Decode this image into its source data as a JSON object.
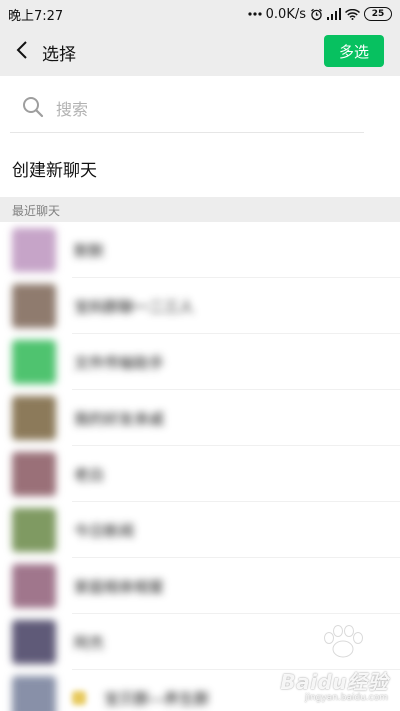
{
  "status_bar": {
    "time": "晚上7:27",
    "net_speed": "0.0K/s",
    "battery": "25"
  },
  "header": {
    "title": "选择",
    "multi_select": "多选"
  },
  "search": {
    "placeholder": "搜索"
  },
  "create_chat": "创建新聊天",
  "section_title": "最近聊天",
  "recent_chats": [
    {
      "name": "默默",
      "avatar_color": "#c6a4c8"
    },
    {
      "name": "宝妈群聊一二三人",
      "avatar_color": "#8f7b6e"
    },
    {
      "name": "文件传输助手",
      "avatar_color": "#4fc36f"
    },
    {
      "name": "我的好友亲戚",
      "avatar_color": "#8c7a5a"
    },
    {
      "name": "老白",
      "avatar_color": "#9a7078"
    },
    {
      "name": "今日新闻",
      "avatar_color": "#7f9a62"
    },
    {
      "name": "家庭相亲相爱",
      "avatar_color": "#a0768c"
    },
    {
      "name": "阿杰",
      "avatar_color": "#5f5a78"
    },
    {
      "name": "宝贝群—养生群",
      "avatar_color": "#8890a8"
    }
  ],
  "watermark": {
    "brand": "Baidu经验",
    "url": "jingyan.baidu.com"
  },
  "colors": {
    "accent": "#07c160",
    "background_gray": "#ededed"
  }
}
